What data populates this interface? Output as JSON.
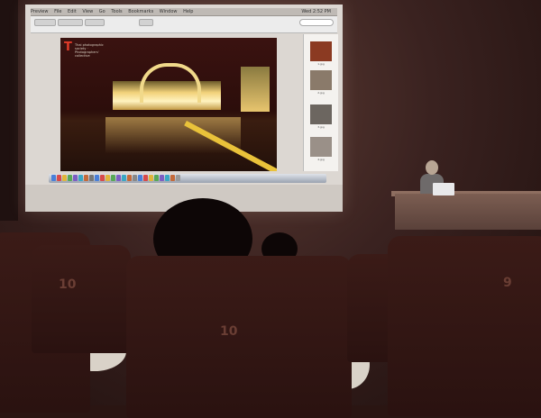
{
  "screen": {
    "menubar": {
      "items": [
        "Preview",
        "File",
        "Edit",
        "View",
        "Go",
        "Tools",
        "Bookmarks",
        "Window",
        "Help"
      ],
      "clock": "Wed 2:52 PM"
    },
    "document_title": "P..jpg (4/5 documents, 4/5 total pages)"
  },
  "photo": {
    "logo_letter": "T",
    "logo_caption": "Thai photographic society · Photographers' collective"
  },
  "sidebar": {
    "thumbnails": [
      {
        "caption": "1.jpg"
      },
      {
        "caption": "2.jpg"
      },
      {
        "caption": "3.jpg"
      },
      {
        "caption": "4.jpg"
      }
    ]
  },
  "seats": {
    "left_number": "10",
    "center_number": "10",
    "right_number": "9"
  }
}
